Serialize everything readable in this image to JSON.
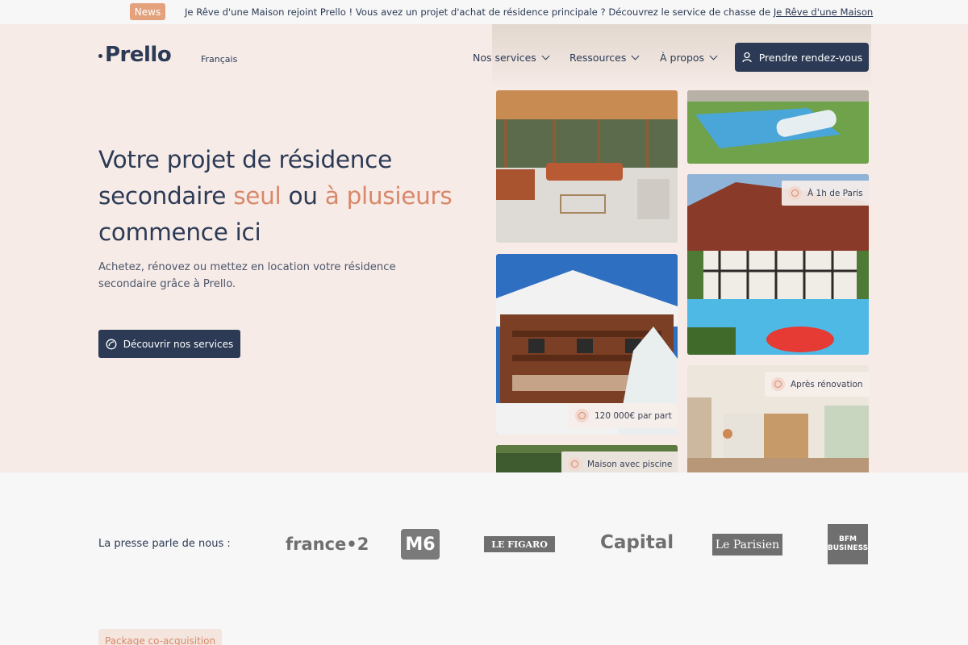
{
  "news": {
    "badge": "News",
    "text": "Je Rêve d'une Maison rejoint Prello ! Vous avez un projet d'achat de résidence principale ? Découvrez le service de chasse de ",
    "link": "Je Rêve d'une Maison"
  },
  "header": {
    "logo": "Prello",
    "language": "Français",
    "nav": [
      {
        "label": "Nos services"
      },
      {
        "label": "Ressources"
      },
      {
        "label": "À propos"
      }
    ],
    "cta": "Prendre rendez-vous"
  },
  "hero": {
    "title_part1": "Votre projet de résidence secondaire ",
    "title_accent1": "seul",
    "title_part2": " ou ",
    "title_accent2": "à plusieurs",
    "title_part3": " commence ici",
    "subtitle": "Achetez, rénovez ou mettez en location votre résidence secondaire grâce à Prello.",
    "button": "Découvrir nos services"
  },
  "tiles": {
    "paris": "À 1h de Paris",
    "price": "120 000€ par part",
    "renovation": "Après rénovation",
    "pool": "Maison avec piscine"
  },
  "press": {
    "label": "La presse parle de nous :",
    "logos": [
      "france•2",
      "M6",
      "LE FIGARO",
      "Capital",
      "Le Parisien",
      "BFM BUSINESS"
    ]
  },
  "package": "Package co-acquisition",
  "colors": {
    "navy": "#2c3a55",
    "accent": "#d8886a",
    "hero_bg": "#f6ebe7"
  }
}
